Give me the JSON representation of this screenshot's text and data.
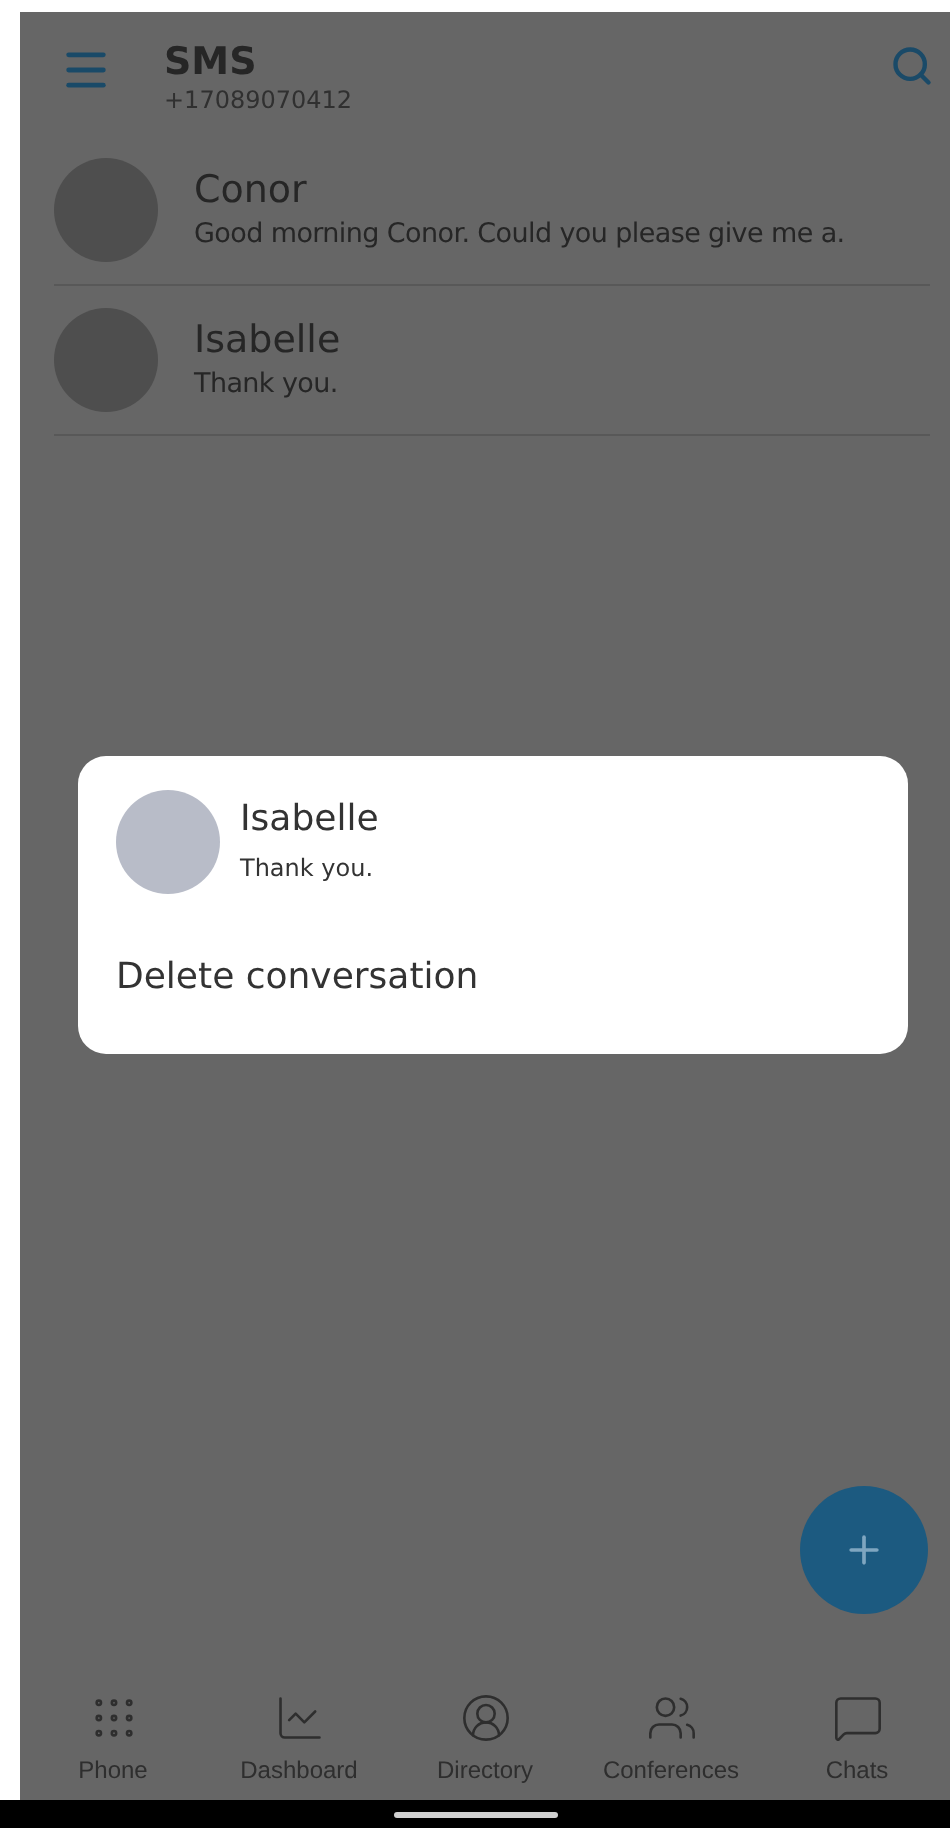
{
  "header": {
    "title": "SMS",
    "subtitle": "+17089070412"
  },
  "conversations": [
    {
      "name": "Conor",
      "preview": "Good morning Conor. Could you please give me a."
    },
    {
      "name": "Isabelle",
      "preview": "Thank you."
    }
  ],
  "dialog": {
    "name": "Isabelle",
    "preview": "Thank you.",
    "actions": [
      "Delete conversation"
    ]
  },
  "bottom_nav": [
    {
      "label": "Phone"
    },
    {
      "label": "Dashboard"
    },
    {
      "label": "Directory"
    },
    {
      "label": "Conferences"
    },
    {
      "label": "Chats"
    }
  ]
}
